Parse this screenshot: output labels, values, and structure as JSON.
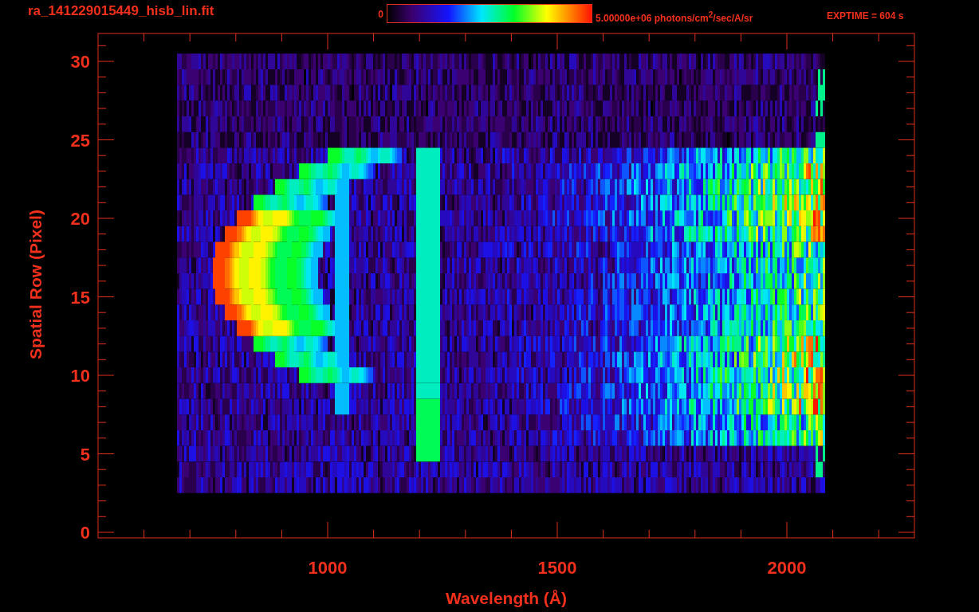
{
  "title": "ra_141229015449_hisb_lin.fit",
  "colorbar": {
    "min_label": "0",
    "max_label": "5.00000e+06 photons/cm$^{2}$/sec/A/sr"
  },
  "exposure": "EXPTIME = 604 s",
  "plot": {
    "xlabel": "Wavelength (Å)",
    "ylabel": "Spatial Row (Pixel)",
    "xticks": [
      "1000",
      "1500",
      "2000"
    ],
    "yticks": [
      "30",
      "25",
      "20",
      "15",
      "10",
      "5",
      "0"
    ]
  }
}
